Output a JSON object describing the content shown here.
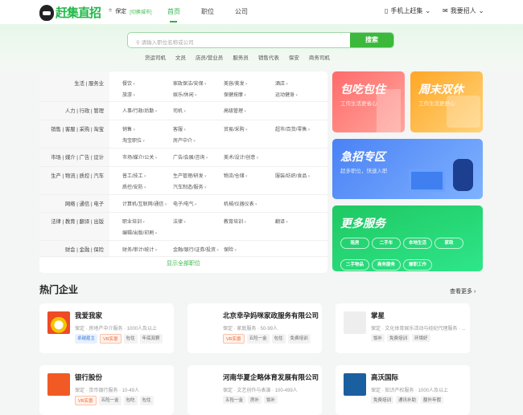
{
  "header": {
    "logo": "赶集直招",
    "location": "保定",
    "switch_city": "[切换城市]",
    "nav": [
      "首页",
      "职位",
      "公司"
    ],
    "mobile": "手机上赶集",
    "recruit": "我要招人"
  },
  "search": {
    "placeholder": "请输入职位名称或公司",
    "button": "搜索",
    "hot": [
      "货运司机",
      "文员",
      "店员/营业员",
      "服务员",
      "销售代表",
      "保安",
      "商务司机"
    ]
  },
  "categories": [
    {
      "label": "生活 | 服务业",
      "items": [
        "餐饮",
        "家政保洁/安保",
        "美容/美发",
        "酒店",
        "旅游",
        "娱乐/休闲",
        "保健按摩",
        "运动健身"
      ]
    },
    {
      "label": "人力 | 行政 | 管理",
      "items": [
        "人事/行政/后勤",
        "司机",
        "高级管理"
      ]
    },
    {
      "label": "销售 | 客服 | 采购 | 淘宝",
      "items": [
        "销售",
        "客服",
        "贸易/采购",
        "超市/百货/零售",
        "淘宝职位",
        "房产中介"
      ]
    },
    {
      "label": "市场 | 媒介 | 广告 | 设计",
      "items": [
        "市场/媒介/公关",
        "广告/会展/咨询",
        "美术/设计/创意"
      ]
    },
    {
      "label": "生产 | 物流 | 质控 | 汽车",
      "items": [
        "普工/技工",
        "生产管理/研发",
        "物流/仓储",
        "服装/纺织/食品",
        "质控/安防",
        "汽车制造/服务"
      ]
    },
    {
      "label": "网络 | 通信 | 电子",
      "items": [
        "计算机/互联网/通信",
        "电子/电气",
        "机械/仪器仪表"
      ]
    },
    {
      "label": "法律 | 教育 | 翻译 | 出版",
      "items": [
        "职业培训",
        "法律",
        "教育培训",
        "翻译",
        "编辑/出版/印刷"
      ]
    },
    {
      "label": "财会 | 金融 | 保险",
      "items": [
        "财务/审计/统计",
        "金融/银行/证券/投资",
        "保险"
      ]
    }
  ],
  "show_all": "显示全部职位",
  "promos": {
    "board": {
      "title": "包吃包住",
      "sub": "工作生活更省心"
    },
    "weekend": {
      "title": "周末双休",
      "sub": "工作生活更舒心"
    },
    "urgent": {
      "title": "急招专区",
      "sub": "超多职位，快速入职"
    },
    "services": {
      "title": "更多服务",
      "items": [
        "租房",
        "二手车",
        "本地生活",
        "家政",
        "二手物品",
        "商务服务",
        "兼职工作"
      ]
    }
  },
  "companies": {
    "title": "热门企业",
    "more": "查看更多",
    "list": [
      {
        "name": "我爱我家",
        "meta": "保定 · 房地产中介服务 · 1000人及以上",
        "tags": [
          "卓越雇主",
          "VR实景",
          "包住",
          "年底双薪"
        ]
      },
      {
        "name": "北京幸孕妈咪家政服务有限公司",
        "meta": "保定 · 家庭服务 · 50-99人",
        "tags": [
          "VR实景",
          "五险一金",
          "包住",
          "免费培训"
        ]
      },
      {
        "name": "掌星",
        "meta": "保定 · 文化体育娱乐活动与经纪代理服务 · ...",
        "tags": [
          "饭补",
          "免费培训",
          "环境好"
        ]
      },
      {
        "name": "银行股份",
        "meta": "保定 · 货币银行服务 · 10-49人",
        "tags": [
          "VR实景",
          "五险一金",
          "包吃",
          "包住"
        ]
      },
      {
        "name": "河南华夏企略体育发展有限公司",
        "meta": "保定 · 文艺创作与表演 · 100-499人",
        "tags": [
          "五险一金",
          "房补",
          "饭补"
        ]
      },
      {
        "name": "高沃国际",
        "meta": "保定 · 知识产权服务 · 1000人及以上",
        "tags": [
          "免费培训",
          "通讯补助",
          "额外年假"
        ]
      }
    ]
  },
  "colors": {
    "brand": "#2bb34a",
    "search_btn": "#3cb93c"
  }
}
